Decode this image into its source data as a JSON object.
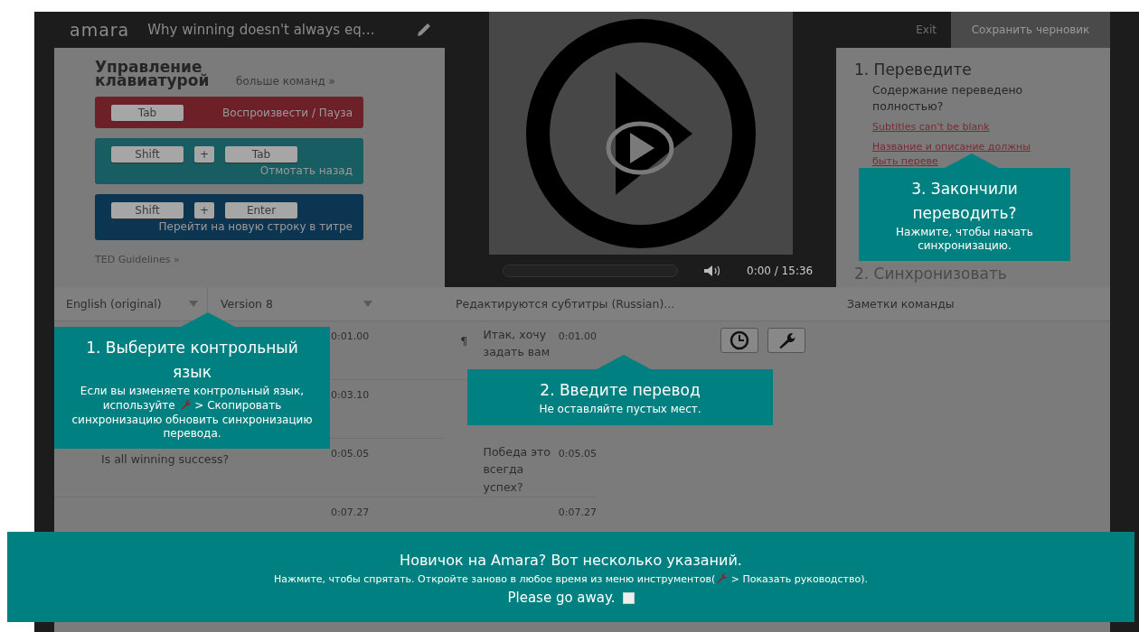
{
  "header": {
    "logo": "amara",
    "title": "Why winning doesn't always eq…",
    "exit": "Exit",
    "save": "Сохранить черновик"
  },
  "keyboard": {
    "title": "Управление клавиатурой",
    "more": "больше команд »",
    "guidelines": "TED Guidelines »",
    "shortcuts": [
      {
        "color": "#6e2029",
        "keys": [
          "Tab"
        ],
        "action": "Воспроизвести / Пауза"
      },
      {
        "color": "#175d61",
        "keys": [
          "Shift",
          "Tab"
        ],
        "joiner": "+",
        "action": "Отмотать назад"
      },
      {
        "color": "#0b3551",
        "keys": [
          "Shift",
          "Enter"
        ],
        "joiner": "+",
        "action": "Перейти на новую строку в титре"
      }
    ]
  },
  "video": {
    "time": "0:00 / 15:36"
  },
  "steps": {
    "heading": "1. Переведите",
    "question": "Содержание переведено полностью?",
    "errors": [
      "Subtitles can't be blank",
      "Название и описание должны быть переве"
    ],
    "next": "2. Синхронизовать"
  },
  "reference": {
    "language": "English (original)",
    "version": "Version 8",
    "rows": [
      {
        "time": "0:01.00"
      },
      {
        "time": "0:03.10"
      },
      {
        "text": "Is all winning success?",
        "time": "0:05.05"
      },
      {
        "time": "0:07.27"
      }
    ]
  },
  "editor": {
    "title": "Редактируются субтитры (Russian)...",
    "rows": [
      {
        "mark": "¶",
        "text": "Итак, хочу задать вам",
        "time": "0:01.00"
      },
      {
        "text": "Победа это всегда успех?",
        "time": "0:05.05"
      },
      {
        "time": "0:07.27"
      }
    ]
  },
  "notes": {
    "title": "Заметки команды"
  },
  "tips": [
    {
      "title": "1. Выберите контрольный язык",
      "before": "Если вы изменяете контрольный язык, используйте",
      "after": "> Скопировать синхронизацию обновить синхронизацию перевода."
    },
    {
      "title": "2. Введите перевод",
      "before": "Не оставляйте пустых мест."
    },
    {
      "title": "3. Закончили переводить?",
      "before": "Нажмите, чтобы начать синхронизацию."
    }
  ],
  "banner": {
    "title": "Новичок на Amara? Вот несколько указаний.",
    "before": "Нажмите, чтобы спрятать. Откройте заново в любое время из меню инструментов(",
    "after": "> Показать руководство).",
    "dismiss": "Please go away.",
    "checked": false
  }
}
